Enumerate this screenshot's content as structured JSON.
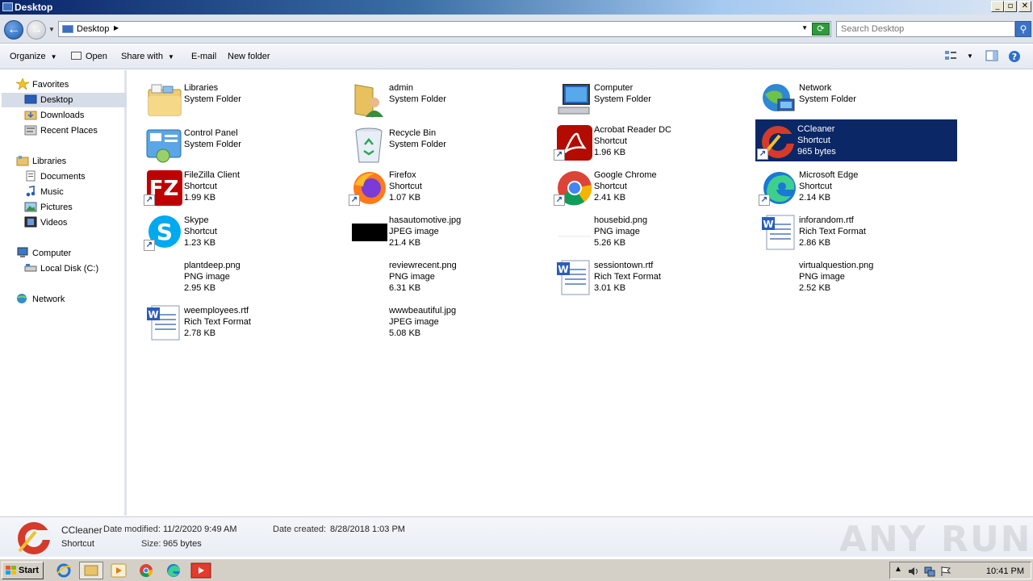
{
  "window": {
    "title": "Desktop",
    "minimize": "_",
    "maximize": "▫",
    "close": "✕"
  },
  "address": {
    "location": "Desktop",
    "search_placeholder": "Search Desktop"
  },
  "toolbar": {
    "organize": "Organize",
    "open": "Open",
    "share_with": "Share with",
    "email": "E-mail",
    "new_folder": "New folder"
  },
  "sidebar": {
    "favorites": "Favorites",
    "desktop": "Desktop",
    "downloads": "Downloads",
    "recent_places": "Recent Places",
    "libraries": "Libraries",
    "documents": "Documents",
    "music": "Music",
    "pictures": "Pictures",
    "videos": "Videos",
    "computer": "Computer",
    "local_disk": "Local Disk (C:)",
    "network": "Network"
  },
  "items": [
    {
      "name": "Libraries",
      "type": "System Folder",
      "size": "",
      "icon": "libraries-icon"
    },
    {
      "name": "admin",
      "type": "System Folder",
      "size": "",
      "icon": "user-folder-icon"
    },
    {
      "name": "Computer",
      "type": "System Folder",
      "size": "",
      "icon": "computer-icon"
    },
    {
      "name": "Network",
      "type": "System Folder",
      "size": "",
      "icon": "network-icon"
    },
    {
      "name": "Control Panel",
      "type": "System Folder",
      "size": "",
      "icon": "control-panel-icon"
    },
    {
      "name": "Recycle Bin",
      "type": "System Folder",
      "size": "",
      "icon": "recycle-bin-icon"
    },
    {
      "name": "Acrobat Reader DC",
      "type": "Shortcut",
      "size": "1.96 KB",
      "icon": "acrobat-icon"
    },
    {
      "name": "CCleaner",
      "type": "Shortcut",
      "size": "965 bytes",
      "icon": "ccleaner-icon"
    },
    {
      "name": "FileZilla Client",
      "type": "Shortcut",
      "size": "1.99 KB",
      "icon": "filezilla-icon"
    },
    {
      "name": "Firefox",
      "type": "Shortcut",
      "size": "1.07 KB",
      "icon": "firefox-icon"
    },
    {
      "name": "Google Chrome",
      "type": "Shortcut",
      "size": "2.41 KB",
      "icon": "chrome-icon"
    },
    {
      "name": "Microsoft Edge",
      "type": "Shortcut",
      "size": "2.14 KB",
      "icon": "edge-icon"
    },
    {
      "name": "Skype",
      "type": "Shortcut",
      "size": "1.23 KB",
      "icon": "skype-icon"
    },
    {
      "name": "hasautomotive.jpg",
      "type": "JPEG image",
      "size": "21.4 KB",
      "icon": "jpeg-thumbnail-icon"
    },
    {
      "name": "housebid.png",
      "type": "PNG image",
      "size": "5.26 KB",
      "icon": "png-thumbnail-icon"
    },
    {
      "name": "inforandom.rtf",
      "type": "Rich Text Format",
      "size": "2.86 KB",
      "icon": "wordpad-document-icon"
    },
    {
      "name": "plantdeep.png",
      "type": "PNG image",
      "size": "2.95 KB",
      "icon": "png-thumbnail-icon"
    },
    {
      "name": "reviewrecent.png",
      "type": "PNG image",
      "size": "6.31 KB",
      "icon": "png-thumbnail-icon"
    },
    {
      "name": "sessiontown.rtf",
      "type": "Rich Text Format",
      "size": "3.01 KB",
      "icon": "wordpad-document-icon"
    },
    {
      "name": "virtualquestion.png",
      "type": "PNG image",
      "size": "2.52 KB",
      "icon": "png-thumbnail-icon"
    },
    {
      "name": "weemployees.rtf",
      "type": "Rich Text Format",
      "size": "2.78 KB",
      "icon": "wordpad-document-icon"
    },
    {
      "name": "wwwbeautiful.jpg",
      "type": "JPEG image",
      "size": "5.08 KB",
      "icon": "jpeg-thumbnail-icon"
    }
  ],
  "details": {
    "name": "CCleaner",
    "type": "Shortcut",
    "modified_label": "Date modified:",
    "modified_value": "11/2/2020 9:49 AM",
    "created_label": "Date created:",
    "created_value": "8/28/2018 1:03 PM",
    "size_label": "Size:",
    "size_value": "965 bytes"
  },
  "watermark": "ANY RUN",
  "taskbar": {
    "start": "Start",
    "clock": "10:41 PM"
  },
  "colors": {
    "selection": "#0b2766",
    "sidebar_selection": "#d6dce8"
  }
}
